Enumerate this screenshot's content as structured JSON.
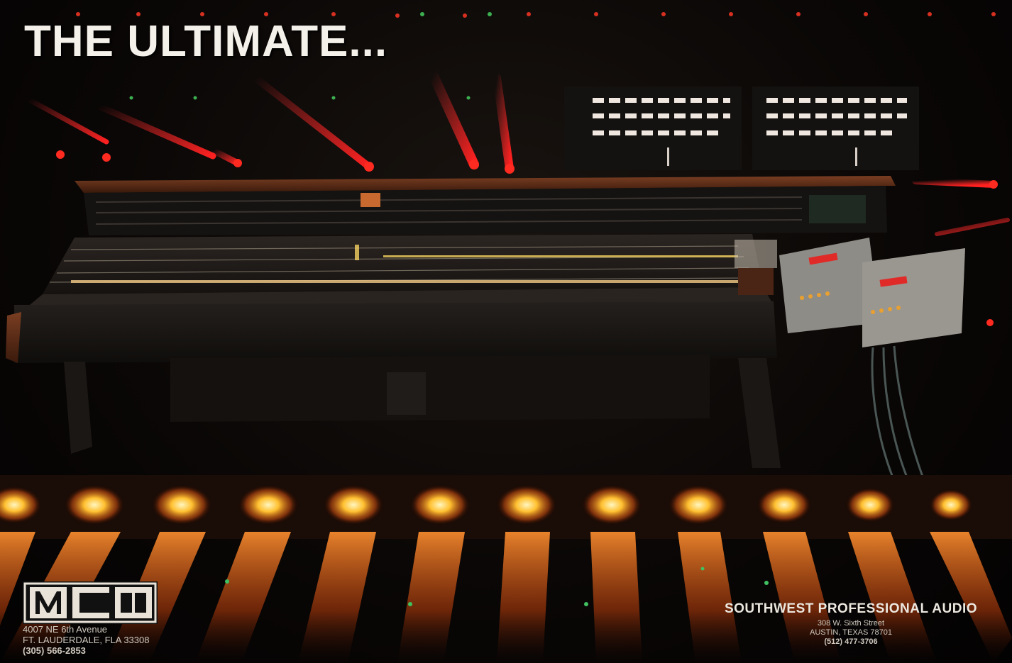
{
  "headline": "THE ULTIMATE...",
  "brand": {
    "logo_text": "MCI",
    "address_line1": "4007 NE 6th Avenue",
    "address_line2": "FT. LAUDERDALE, FLA 33308",
    "phone": "(305) 566-2853"
  },
  "dealer": {
    "name": "SOUTHWEST PROFESSIONAL AUDIO",
    "address_line1": "308 W. Sixth Street",
    "address_line2": "AUSTIN, TEXAS 78701",
    "phone": "(512) 477-3706"
  },
  "colors": {
    "background": "#050302",
    "console_wood": "#5a2e1a",
    "light_amber": "#ffb020",
    "light_red": "#e8202a"
  }
}
